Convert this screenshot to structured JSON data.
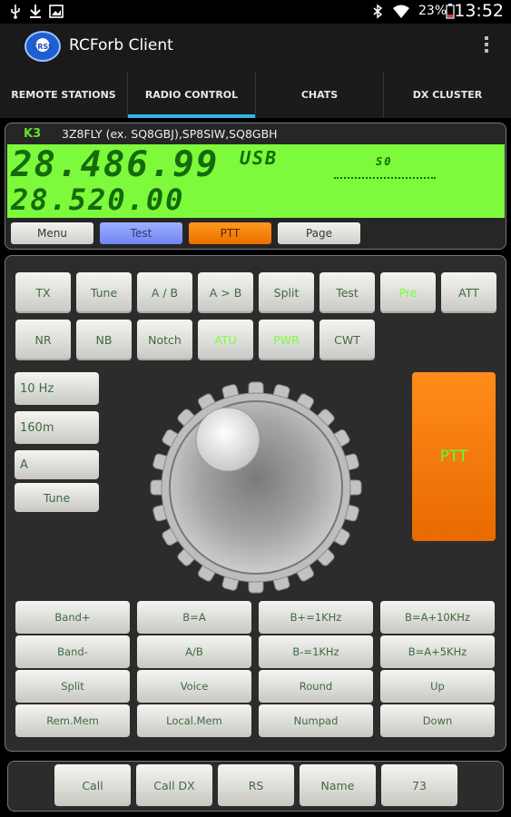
{
  "status_bar": {
    "battery_text": "23%",
    "time": "13:52",
    "icons": [
      "usb-icon",
      "download-icon",
      "image-icon",
      "bluetooth-icon",
      "wifi-icon",
      "battery-icon"
    ]
  },
  "app_bar": {
    "logo_text": "CRSS",
    "title": "RCForb Client",
    "overflow_icon": "overflow-menu-icon"
  },
  "tabs": [
    {
      "label": "REMOTE STATIONS",
      "active": false
    },
    {
      "label": "RADIO CONTROL",
      "active": true
    },
    {
      "label": "CHATS",
      "active": false
    },
    {
      "label": "DX CLUSTER",
      "active": false
    }
  ],
  "radio": {
    "model": "K3",
    "callsign": "3Z8FLY (ex. SQ8GBJ),SP8SIW,SQ8GBH",
    "vfo_a": "28.486.99",
    "vfo_b": "28.520.00",
    "mode": "USB",
    "s_meter": "S0",
    "top_buttons": [
      "Menu",
      "Test",
      "PTT",
      "Page"
    ]
  },
  "controls": {
    "row1": [
      "TX",
      "Tune",
      "A / B",
      "A > B",
      "Split",
      "Test",
      "Pre",
      "ATT"
    ],
    "row2": [
      "NR",
      "NB",
      "Notch",
      "ATU",
      "PWR",
      "CWT"
    ],
    "step": "10 Hz",
    "band": "160m",
    "vfo": "A",
    "tune": "Tune",
    "ptt": "PTT",
    "grid": [
      [
        "Band+",
        "B=A",
        "B+=1KHz",
        "B=A+10KHz"
      ],
      [
        "Band-",
        "A/B",
        "B-=1KHz",
        "B=A+5KHz"
      ],
      [
        "Split",
        "Voice",
        "Round",
        "Up"
      ],
      [
        "Rem.Mem",
        "Local.Mem",
        "Numpad",
        "Down"
      ]
    ]
  },
  "bottom_buttons": [
    "Call",
    "Call DX",
    "RS",
    "Name",
    "73"
  ],
  "colors": {
    "lcd": "#7dfa3b",
    "accent": "#33b5e5",
    "ptt": "#ff8c1a",
    "test_button": "#8c9cf8"
  }
}
